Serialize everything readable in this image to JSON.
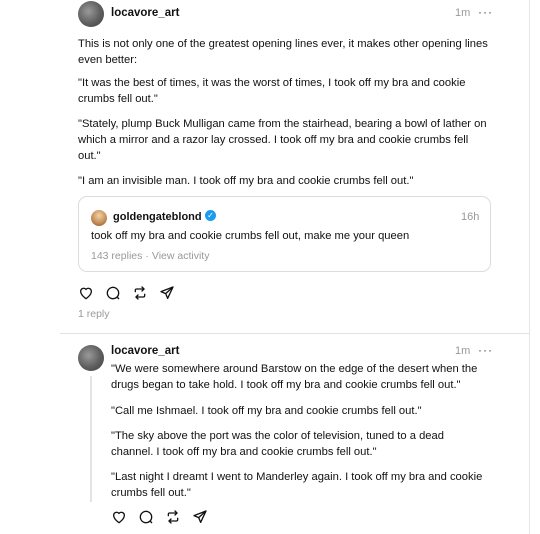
{
  "post1": {
    "username": "locavore_art",
    "time": "1m",
    "more_glyph": "···",
    "paragraphs": [
      "This is not only one of the greatest opening lines ever, it makes other opening lines",
      "even better:",
      "\"It was the best of times, it was the worst of times, I took off my bra and cookie",
      "crumbs fell out.\"",
      "\"Stately, plump Buck Mulligan came from the stairhead, bearing a bowl of lather on",
      "which a mirror and a razor lay crossed. I took off my bra and cookie crumbs fell",
      "out.\"",
      "\"I am an invisible man. I took off my bra and cookie crumbs fell out.\""
    ],
    "quote": {
      "username": "goldengateblond",
      "time": "16h",
      "text": "took off my bra and cookie crumbs fell out, make me your queen",
      "replies": "143 replies",
      "view_activity": "View activity"
    },
    "reply_count": "1 reply",
    "actions": [
      "heart-icon",
      "comment-icon",
      "repost-icon",
      "share-icon"
    ]
  },
  "post2": {
    "username": "locavore_art",
    "time": "1m",
    "more_glyph": "···",
    "paragraphs": [
      "\"We were somewhere around Barstow on the edge of the desert when the",
      "drugs began to take hold. I took off my bra and cookie crumbs fell out.\"",
      "\"Call me Ishmael. I took off my bra and cookie crumbs fell out.\"",
      "\"The sky above the port was the color of television, tuned to a dead",
      "channel. I took off my bra and cookie crumbs fell out.\"",
      "\"Last night I dreamt I went to Manderley again. I took off my bra and cookie",
      "crumbs fell out.\""
    ],
    "actions": [
      "heart-icon",
      "comment-icon",
      "repost-icon",
      "share-icon"
    ]
  },
  "colors": {
    "muted": "#999999",
    "verified": "#1d9bf0",
    "divider": "#e2e2e2"
  }
}
